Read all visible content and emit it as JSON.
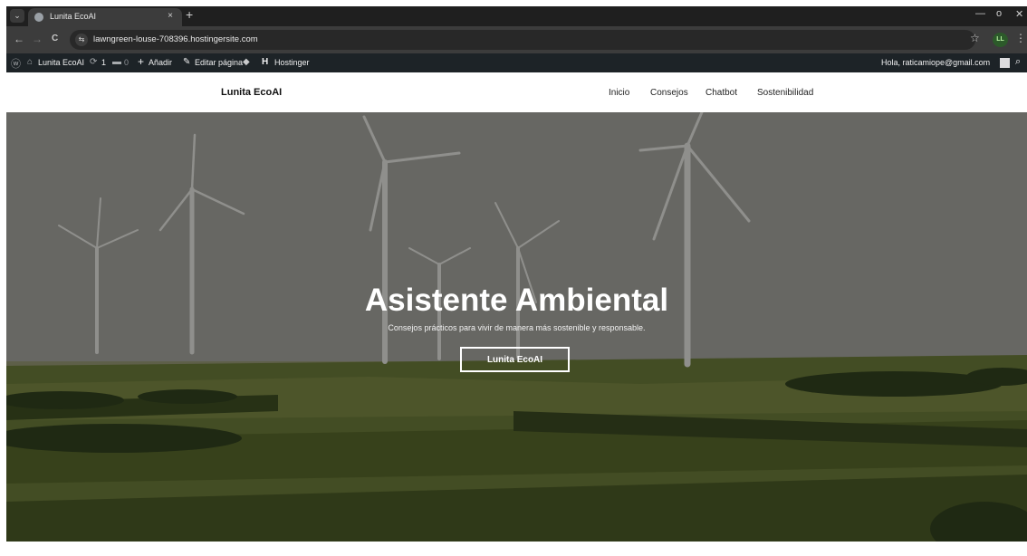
{
  "browser": {
    "tab_title": "Lunita EcoAI",
    "tab_close": "×",
    "new_tab": "+",
    "back": "←",
    "forward": "→",
    "reload": "C",
    "site_info": "⇆",
    "url": "lawngreen-louse-708396.hostingersite.com",
    "bookmark": "☆",
    "profile_initials": "LL",
    "menu": "⋮",
    "minimize": "—",
    "maximize": "ᴏ",
    "close": "✕"
  },
  "admin_bar": {
    "site_name": "Lunita EcoAI",
    "updates_count": "1",
    "comments_count": "0",
    "add_new": "Añadir",
    "edit_page": "Editar página",
    "hostinger": "Hostinger",
    "greeting": "Hola, raticamiope@gmail.com"
  },
  "site": {
    "brand": "Lunita EcoAI",
    "menu": [
      "Inicio",
      "Consejos",
      "Chatbot",
      "Sostenibilidad"
    ]
  },
  "hero": {
    "title": "Asistente Ambiental",
    "subtitle": "Consejos prácticos para vivir de manera más sostenible y responsable.",
    "cta": "Lunita EcoAI"
  },
  "colors": {
    "chrome_dark": "#1f1f1f",
    "admin_bar": "#1d2327",
    "hero_overlay": "rgba(0,0,0,0.38)"
  }
}
